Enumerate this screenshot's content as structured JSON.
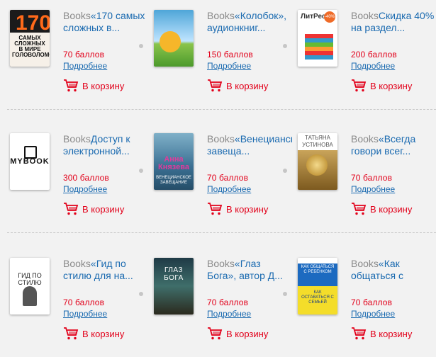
{
  "common": {
    "category": "Books",
    "more_label": "Подробнее",
    "cart_label": "В корзину"
  },
  "colors": {
    "background": "#f2f2f2",
    "link": "#1a6ab0",
    "price": "#e2001a",
    "category": "#8a8a8a"
  },
  "items": [
    {
      "title": "«170 самых сложных в...",
      "price": "70 баллов",
      "cover_text": "170",
      "cover_sub": "САМЫХ СЛОЖНЫХ В МИРЕ ГОЛОВОЛОМОК"
    },
    {
      "title": "«Колобок», аудионкниг...",
      "price": "150 баллов"
    },
    {
      "title": "Скидка 40% на раздел...",
      "price": "200 баллов",
      "cover_text": "ЛитРес:",
      "cover_sub": "-40%"
    },
    {
      "title": "Доступ к электронной...",
      "price": "300 баллов",
      "cover_text": "MYBOOK"
    },
    {
      "title": "«Венецианское завеща...",
      "price": "70 баллов",
      "cover_text": "Анна Князева",
      "cover_sub": "ВЕНЕЦИАНСКОЕ ЗАВЕЩАНИЕ"
    },
    {
      "title": "«Всегда говори всег...",
      "price": "70 баллов",
      "cover_text": "ТАТЬЯНА УСТИНОВА"
    },
    {
      "title": "«Гид по стилю для на...",
      "price": "70 баллов",
      "cover_text": "ГИД ПО СТИЛЮ"
    },
    {
      "title": "«Глаз Бога», автор Д...",
      "price": "70 баллов",
      "cover_text": "ГЛАЗ БОГА"
    },
    {
      "title": "«Как общаться с ребе...",
      "price": "70 баллов",
      "cover_text": "КАК ОБЩАТЬСЯ С РЕБЕНКОМ",
      "cover_sub": "КАК ОСТАВАТЬСЯ С СЕМЬЕЙ"
    }
  ]
}
